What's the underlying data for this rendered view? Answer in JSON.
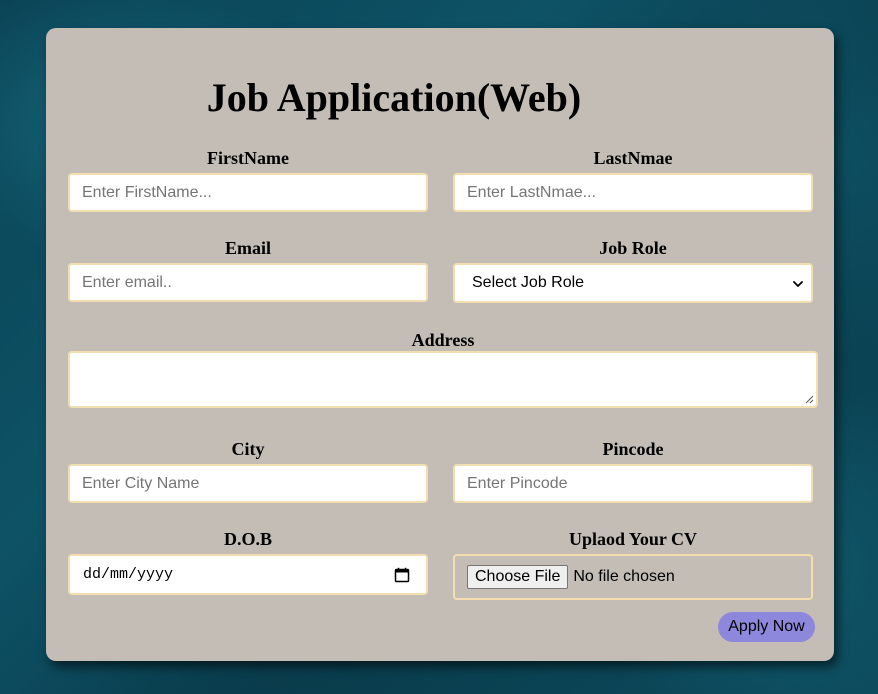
{
  "form": {
    "title": "Job Application(Web)",
    "first_name": {
      "label": "FirstName",
      "placeholder": "Enter FirstName..."
    },
    "last_name": {
      "label": "LastNmae",
      "placeholder": "Enter LastNmae..."
    },
    "email": {
      "label": "Email",
      "placeholder": "Enter email.."
    },
    "job_role": {
      "label": "Job Role",
      "selected": "Select Job Role"
    },
    "address": {
      "label": "Address"
    },
    "city": {
      "label": "City",
      "placeholder": "Enter City Name"
    },
    "pincode": {
      "label": "Pincode",
      "placeholder": "Enter Pincode"
    },
    "dob": {
      "label": "D.O.B",
      "value": "dd/mm/yyyy"
    },
    "cv": {
      "label": "Uplaod Your CV",
      "button": "Choose File",
      "status": "No file chosen"
    },
    "submit_label": "Apply Now"
  },
  "icons": {
    "select_chevron": "chevron-down-icon",
    "date_picker": "calendar-icon",
    "textarea_resize": "resize-handle-icon"
  },
  "colors": {
    "card_background": "#c4bdb6",
    "field_border": "#f3deb0",
    "apply_button": "#8d88db"
  }
}
